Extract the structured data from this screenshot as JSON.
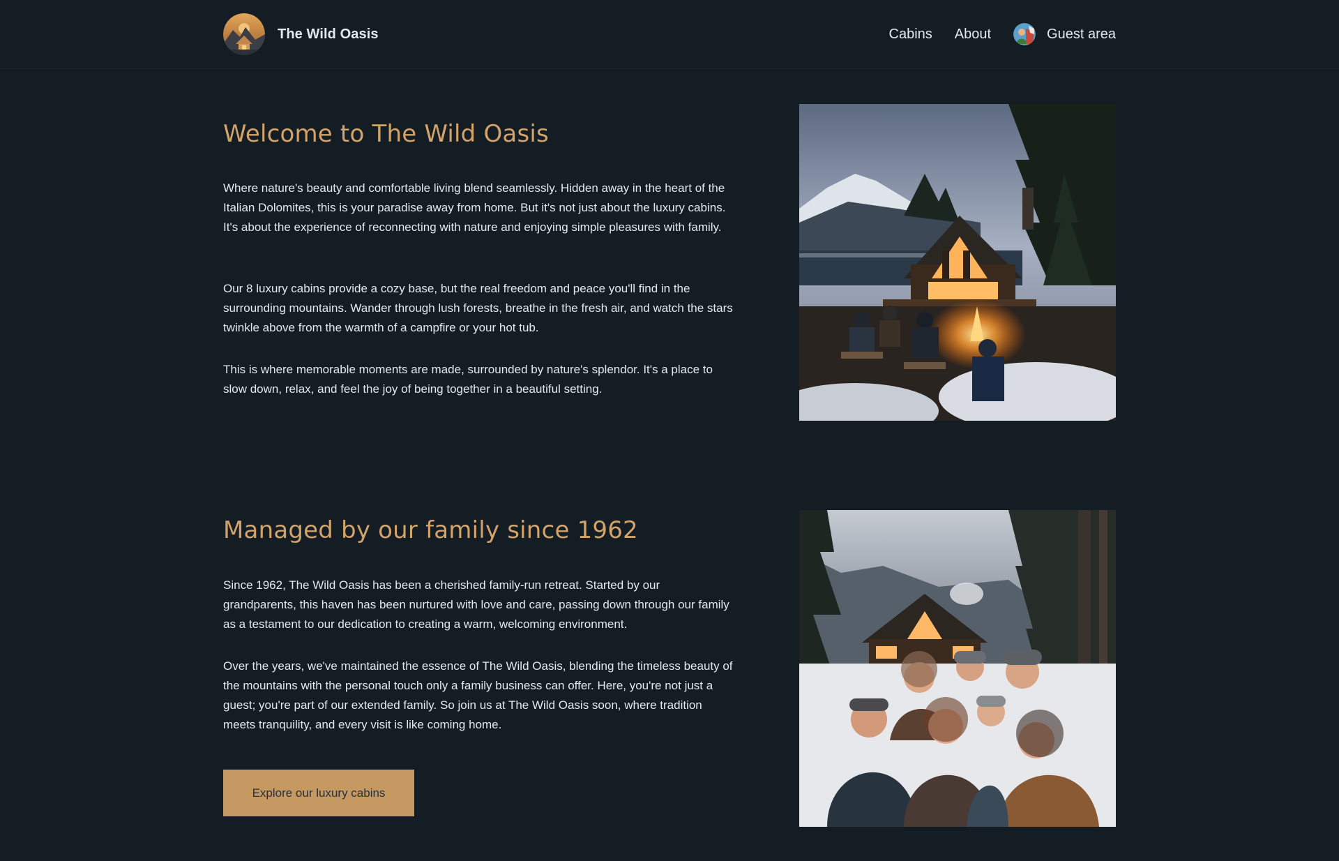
{
  "header": {
    "brand_name": "The Wild Oasis",
    "logo_icon": "mountain-cabin-logo",
    "nav": [
      {
        "label": "Cabins"
      },
      {
        "label": "About"
      },
      {
        "label": "Guest area",
        "icon": "user-avatar"
      }
    ]
  },
  "welcome": {
    "title": "Welcome to The Wild Oasis",
    "paragraphs": [
      "Where nature's beauty and comfortable living blend seamlessly. Hidden away in the heart of the Italian Dolomites, this is your paradise away from home. But it's not just about the luxury cabins. It's about the experience of reconnecting with nature and enjoying simple pleasures with family.",
      "Our 8 luxury cabins provide a cozy base, but the real freedom and peace you'll find in the surrounding mountains. Wander through lush forests, breathe in the fresh air, and watch the stars twinkle above from the warmth of a campfire or your hot tub.",
      "This is where memorable moments are made, surrounded by nature's splendor. It's a place to slow down, relax, and feel the joy of being together in a beautiful setting."
    ]
  },
  "family": {
    "title": "Managed by our family since 1962",
    "paragraphs": [
      "Since 1962, The Wild Oasis has been a cherished family-run retreat. Started by our grandparents, this haven has been nurtured with love and care, passing down through our family as a testament to our dedication to creating a warm, welcoming environment.",
      "Over the years, we've maintained the essence of The Wild Oasis, blending the timeless beauty of the mountains with the personal touch only a family business can offer. Here, you're not just a guest; you're part of our extended family. So join us at The Wild Oasis soon, where tradition meets tranquility, and every visit is like coming home."
    ],
    "cta_label": "Explore our luxury cabins"
  },
  "colors": {
    "background": "#141c24",
    "accent": "#d2a36a",
    "button": "#c69963",
    "text": "#e4e9ee"
  }
}
